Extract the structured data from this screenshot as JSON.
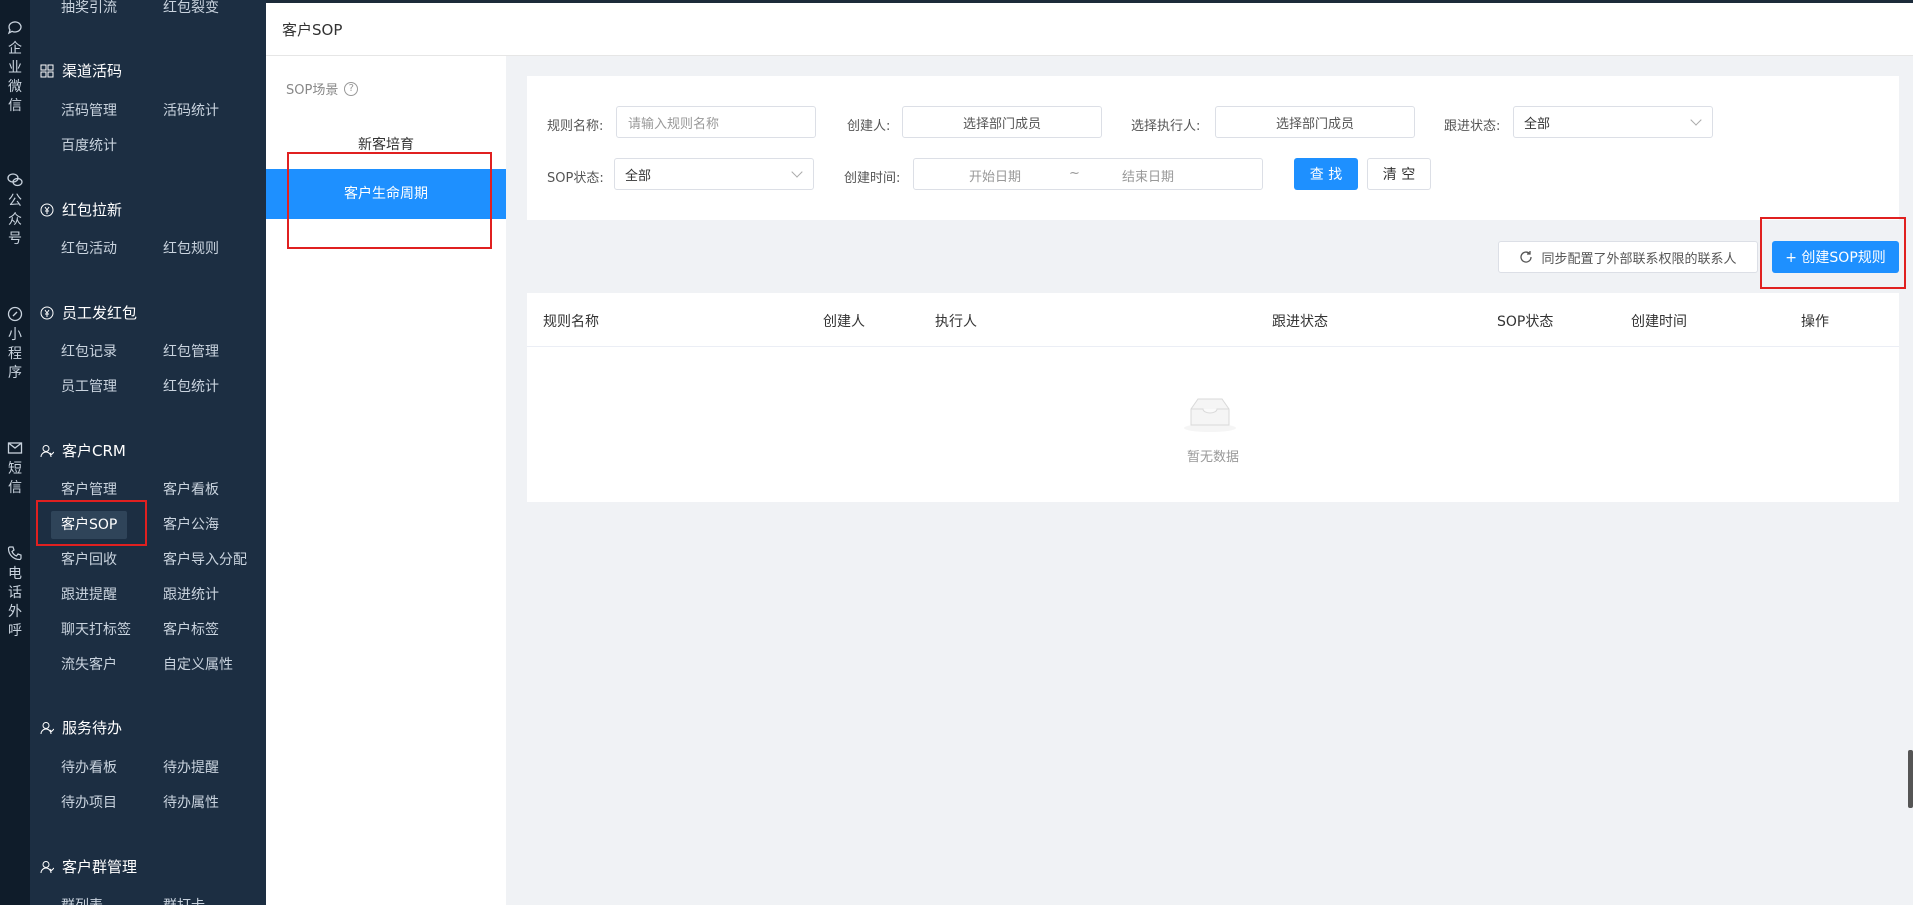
{
  "rail": [
    {
      "icon": "chat-icon",
      "label": "企业微信"
    },
    {
      "icon": "wechat-icon",
      "label": "公众号"
    },
    {
      "icon": "link-icon",
      "label": "小程序"
    },
    {
      "icon": "mail-icon",
      "label": "短信"
    },
    {
      "icon": "phone-icon",
      "label": "电话外呼"
    }
  ],
  "menu": {
    "top_items": [
      "抽奖引流",
      "红包裂变"
    ],
    "groups": [
      {
        "title": "渠道活码",
        "icon": "grid-icon",
        "items": [
          "活码管理",
          "活码统计",
          "百度统计"
        ]
      },
      {
        "title": "红包拉新",
        "icon": "yuan-icon",
        "items": [
          "红包活动",
          "红包规则"
        ]
      },
      {
        "title": "员工发红包",
        "icon": "yuan-icon",
        "items": [
          "红包记录",
          "红包管理",
          "员工管理",
          "红包统计"
        ]
      },
      {
        "title": "客户CRM",
        "icon": "user-icon",
        "items": [
          "客户管理",
          "客户看板",
          "客户SOP",
          "客户公海",
          "客户回收",
          "客户导入分配",
          "跟进提醒",
          "跟进统计",
          "聊天打标签",
          "客户标签",
          "流失客户",
          "自定义属性"
        ]
      },
      {
        "title": "服务待办",
        "icon": "user-icon",
        "items": [
          "待办看板",
          "待办提醒",
          "待办项目",
          "待办属性"
        ]
      },
      {
        "title": "客户群管理",
        "icon": "user-icon",
        "items": [
          "群列表",
          "群打卡"
        ]
      }
    ]
  },
  "header": {
    "title": "客户SOP"
  },
  "scene": {
    "title": "SOP场景",
    "items": [
      "新客培育",
      "客户生命周期"
    ]
  },
  "filter": {
    "rule_name_label": "规则名称:",
    "rule_name_placeholder": "请输入规则名称",
    "creator_label": "创建人:",
    "creator_value": "选择部门成员",
    "executor_label": "选择执行人:",
    "executor_value": "选择部门成员",
    "follow_label": "跟进状态:",
    "follow_value": "全部",
    "sop_status_label": "SOP状态:",
    "sop_status_value": "全部",
    "created_label": "创建时间:",
    "start_placeholder": "开始日期",
    "range_sep": "~",
    "end_placeholder": "结束日期",
    "search_label": "查 找",
    "clear_label": "清 空"
  },
  "actions": {
    "sync_label": "同步配置了外部联系权限的联系人",
    "create_label": "+ 创建SOP规则"
  },
  "table": {
    "columns": [
      "规则名称",
      "创建人",
      "执行人",
      "跟进状态",
      "SOP状态",
      "创建时间",
      "操作"
    ],
    "rows": [],
    "empty_text": "暂无数据"
  },
  "colors": {
    "primary": "#1e90ff",
    "sidebar": "#1c2e42",
    "rail": "#0f1c2a",
    "highlight": "#e02020"
  }
}
